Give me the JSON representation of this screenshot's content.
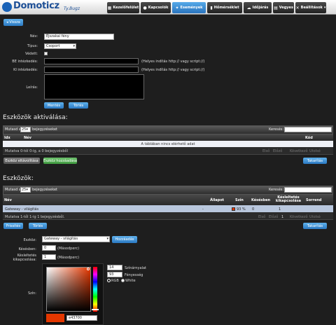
{
  "header": {
    "logo_text": "Domoticz",
    "logo_sub": "Ty.Bugz",
    "nav": [
      {
        "label": "Kezelőfelület",
        "icon": "dashboard-icon"
      },
      {
        "label": "Kapcsolók",
        "icon": "lightbulb-icon"
      },
      {
        "label": "Események",
        "icon": "bolt-icon",
        "active": true
      },
      {
        "label": "Hőmérséklet",
        "icon": "thermometer-icon"
      },
      {
        "label": "Időjárás",
        "icon": "cloud-icon"
      },
      {
        "label": "Vegyes",
        "icon": "grid-icon"
      },
      {
        "label": "Beállítások",
        "icon": "wrench-icon"
      }
    ],
    "settings_caret": "▾"
  },
  "back_button": "◂ Vissza",
  "form": {
    "name_label": "Név:",
    "name_value": "Éjszakai fény",
    "type_label": "Típus:",
    "type_value": "Csoport",
    "protected_label": "Védett:",
    "on_action_label": "BE intézkedés:",
    "off_action_label": "KI intézkedés:",
    "action_hint": "(Helyes indítás http:// vagy script://)",
    "description_label": "Leírás:",
    "save_button": "Mentés",
    "delete_button": "Törlés"
  },
  "activation": {
    "title": "Eszközök aktiválása:",
    "show_prefix": "Mutasd a",
    "show_count": "25",
    "show_suffix": "bejegyzéseket",
    "search_label": "Keresés:",
    "columns": [
      "Idx",
      "Név",
      "Kód"
    ],
    "empty_message": "A táblában nincs elérhető adat",
    "info": "Mutatva 0-tól 0-ig, a 0 bejegyzésből",
    "pager": [
      "Első",
      "Előző",
      "Következő",
      "Utolsó"
    ],
    "remove_button": "Eszköz eltávolítása",
    "add_button": "Eszköz hozzáadása",
    "clear_button": "Takarítás"
  },
  "devices": {
    "title": "Eszközök:",
    "show_prefix": "Mutasd a",
    "show_count": "25",
    "show_suffix": "bejegyzéseket",
    "search_label": "Keresés:",
    "columns": [
      "Név",
      "Állapot",
      "Szín",
      "Késésben",
      "Késleltetés kikapcsolása",
      "Sorrend"
    ],
    "rows": [
      {
        "name": "Gateway - világítás",
        "state": "-",
        "color_value": "93 %",
        "color": "#e43700",
        "delay": "0",
        "off_delay": "1"
      }
    ],
    "info": "Mutatva 1-től 1-ig 1 bejegyzésből.",
    "pager": [
      "Első",
      "Előző",
      "1",
      "Következő",
      "Utolsó"
    ],
    "refresh_button": "Frissítés",
    "delete_button": "Törlés",
    "clear_button": "Takarítás"
  },
  "add_device": {
    "device_label": "Eszköz:",
    "device_value": "Gateway - világítás",
    "add_button": "Hozzáadás",
    "delay_label": "Késésben:",
    "delay_value": "0",
    "delay_unit": "(Másodperc)",
    "off_delay_label": "Késleltetés kikapcsolása:",
    "off_delay_value": "1",
    "off_delay_unit": "(Másodperc)",
    "color_label": "Szín:",
    "hue_value": "14",
    "hue_label": "Színárnyalat",
    "brightness_value": "93",
    "brightness_label": "Fényesség",
    "mode_rgb": "RGB",
    "mode_white": "White",
    "hex_value": "e43700",
    "current_color": "#e43700"
  }
}
